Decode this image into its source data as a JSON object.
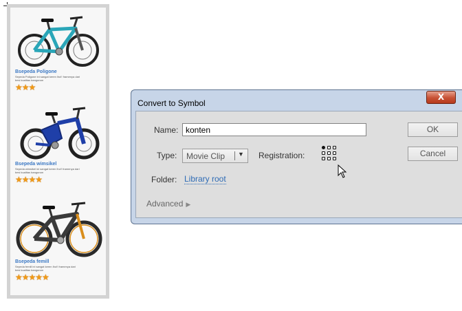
{
  "products": [
    {
      "name": "Bsepeda Poligone",
      "description": "Sepeda Poligone ini sangat keren lho!! framenya dari besi kualitas bangunan",
      "rating": 3,
      "stars": "★★★",
      "frame_color": "#2aa6b8"
    },
    {
      "name": "Bsepeda wimsikel",
      "description": "Sepeda wimsikel ini sangat keren lho!! framenya dari besi kualitas bangunan",
      "rating": 4,
      "stars": "★★★★",
      "frame_color": "#1f3fa8"
    },
    {
      "name": "Bsepeda femill",
      "description": "Sepeda femill ini sangat keren lho!! framenya dari besi kualitas bangunan",
      "rating": 5,
      "stars": "★★★★★",
      "frame_color": "#3a3a3a"
    }
  ],
  "dialog": {
    "title": "Convert to Symbol",
    "close_label": "X",
    "name_label": "Name:",
    "name_value": "konten",
    "type_label": "Type:",
    "type_value": "Movie Clip",
    "type_arrow": "▼",
    "registration_label": "Registration:",
    "registration_selected": "top-left",
    "folder_label": "Folder:",
    "folder_value": "Library root",
    "advanced_label": "Advanced",
    "advanced_arrow": "▶",
    "ok_label": "OK",
    "cancel_label": "Cancel"
  },
  "colors": {
    "dialog_frame": "#c7d5e8",
    "dialog_body": "#dedede",
    "link": "#2e6bb5",
    "close_button": "#c75134",
    "star": "#f19a16",
    "product_title": "#3b78c4"
  },
  "icons": [
    "crosshair-icon",
    "registration-grid-icon",
    "dropdown-arrow-icon",
    "expand-arrow-icon",
    "mouse-cursor-icon",
    "bicycle-icon"
  ]
}
